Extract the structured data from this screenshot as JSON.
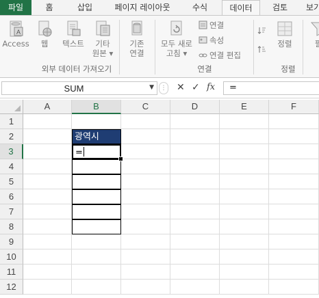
{
  "tabs": [
    "파일",
    "홈",
    "삽입",
    "페이지 레이아웃",
    "수식",
    "데이터",
    "검토",
    "보기"
  ],
  "active_tab": "데이터",
  "ribbon": {
    "get_external": {
      "buttons": [
        {
          "label": "Access",
          "icon": "access-db-icon"
        },
        {
          "label": "웹",
          "icon": "web-globe-icon"
        },
        {
          "label": "텍스트",
          "icon": "text-file-icon"
        },
        {
          "label": "기타",
          "label2": "원본 ▾",
          "icon": "other-sources-icon"
        },
        {
          "label": "기존",
          "label2": "연결",
          "icon": "existing-connections-icon"
        }
      ],
      "group_label": "외부 데이터 가져오기"
    },
    "connections": {
      "refresh_label": "모두 새로",
      "refresh_label2": "고침 ▾",
      "small": [
        "연결",
        "속성",
        "연결 편집"
      ],
      "group_label": "연결"
    },
    "sort": {
      "sort_label": "정렬",
      "group_label": "정렬",
      "filter_label": "필"
    }
  },
  "formula_bar": {
    "name_box": "SUM",
    "cancel": "✕",
    "enter": "✓",
    "fx": "fx",
    "formula": "="
  },
  "columns": [
    "A",
    "B",
    "C",
    "D",
    "E",
    "F"
  ],
  "selected_column": "B",
  "rows": [
    "1",
    "2",
    "3",
    "4",
    "5",
    "6",
    "7",
    "8",
    "9",
    "10",
    "11",
    "12"
  ],
  "selected_row": "3",
  "cells": {
    "B2": "광역시",
    "B3": "="
  }
}
